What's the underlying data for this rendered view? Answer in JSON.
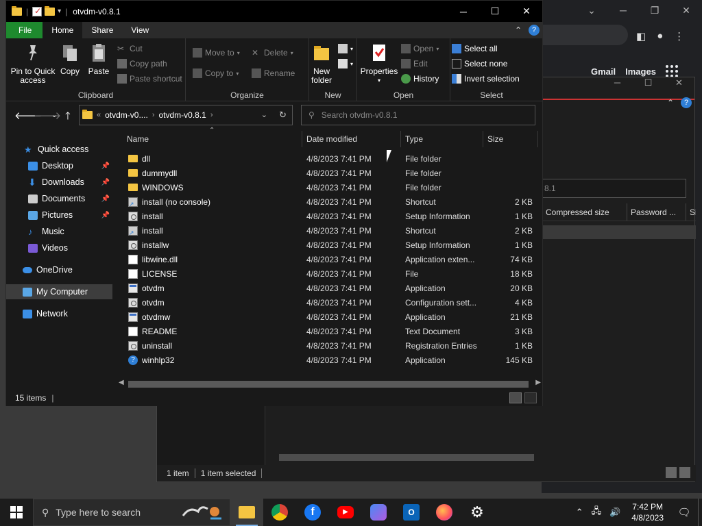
{
  "explorer": {
    "title": "otvdm-v0.8.1",
    "window_buttons": {
      "minimize": "─",
      "maximize": "☐",
      "close": "✕"
    },
    "tabs": [
      {
        "label": "File"
      },
      {
        "label": "Home"
      },
      {
        "label": "Share"
      },
      {
        "label": "View"
      }
    ],
    "ribbon": {
      "clipboard": {
        "label": "Clipboard",
        "pin": "Pin to Quick access",
        "copy": "Copy",
        "paste": "Paste",
        "cut": "Cut",
        "copy_path": "Copy path",
        "paste_shortcut": "Paste shortcut"
      },
      "organize": {
        "label": "Organize",
        "move_to": "Move to",
        "copy_to": "Copy to",
        "delete": "Delete",
        "rename": "Rename"
      },
      "new": {
        "label": "New",
        "new_folder": "New folder"
      },
      "open": {
        "label": "Open",
        "properties": "Properties",
        "open": "Open",
        "edit": "Edit",
        "history": "History"
      },
      "select": {
        "label": "Select",
        "select_all": "Select all",
        "select_none": "Select none",
        "invert_selection": "Invert selection"
      }
    },
    "address": {
      "prefix": "«",
      "crumbs": [
        "otvdm-v0....",
        "otvdm-v0.8.1"
      ],
      "search_placeholder": "Search otvdm-v0.8.1"
    },
    "nav": {
      "quick_access": "Quick access",
      "desktop": "Desktop",
      "downloads": "Downloads",
      "documents": "Documents",
      "pictures": "Pictures",
      "music": "Music",
      "videos": "Videos",
      "onedrive": "OneDrive",
      "my_computer": "My Computer",
      "network": "Network"
    },
    "columns": {
      "name": "Name",
      "date": "Date modified",
      "type": "Type",
      "size": "Size"
    },
    "files": [
      {
        "name": "dll",
        "date": "4/8/2023 7:41 PM",
        "type": "File folder",
        "size": "",
        "icon": "folder"
      },
      {
        "name": "dummydll",
        "date": "4/8/2023 7:41 PM",
        "type": "File folder",
        "size": "",
        "icon": "folder"
      },
      {
        "name": "WINDOWS",
        "date": "4/8/2023 7:41 PM",
        "type": "File folder",
        "size": "",
        "icon": "folder"
      },
      {
        "name": "install (no console)",
        "date": "4/8/2023 7:41 PM",
        "type": "Shortcut",
        "size": "2 KB",
        "icon": "shortcut"
      },
      {
        "name": "install",
        "date": "4/8/2023 7:41 PM",
        "type": "Setup Information",
        "size": "1 KB",
        "icon": "setup"
      },
      {
        "name": "install",
        "date": "4/8/2023 7:41 PM",
        "type": "Shortcut",
        "size": "2 KB",
        "icon": "shortcut"
      },
      {
        "name": "installw",
        "date": "4/8/2023 7:41 PM",
        "type": "Setup Information",
        "size": "1 KB",
        "icon": "setup"
      },
      {
        "name": "libwine.dll",
        "date": "4/8/2023 7:41 PM",
        "type": "Application exten...",
        "size": "74 KB",
        "icon": "doc"
      },
      {
        "name": "LICENSE",
        "date": "4/8/2023 7:41 PM",
        "type": "File",
        "size": "18 KB",
        "icon": "doc"
      },
      {
        "name": "otvdm",
        "date": "4/8/2023 7:41 PM",
        "type": "Application",
        "size": "20 KB",
        "icon": "app"
      },
      {
        "name": "otvdm",
        "date": "4/8/2023 7:41 PM",
        "type": "Configuration sett...",
        "size": "4 KB",
        "icon": "setup"
      },
      {
        "name": "otvdmw",
        "date": "4/8/2023 7:41 PM",
        "type": "Application",
        "size": "21 KB",
        "icon": "app"
      },
      {
        "name": "README",
        "date": "4/8/2023 7:41 PM",
        "type": "Text Document",
        "size": "3 KB",
        "icon": "doc"
      },
      {
        "name": "uninstall",
        "date": "4/8/2023 7:41 PM",
        "type": "Registration Entries",
        "size": "1 KB",
        "icon": "setup"
      },
      {
        "name": "winhlp32",
        "date": "4/8/2023 7:41 PM",
        "type": "Application",
        "size": "145 KB",
        "icon": "help"
      }
    ],
    "status": {
      "items": "15 items"
    }
  },
  "background_zip": {
    "path_fragment": "8.1",
    "columns": [
      "Compressed size",
      "Password ...",
      "Si"
    ],
    "status_items": "1 item",
    "status_selected": "1 item selected"
  },
  "chrome": {
    "gmail": "Gmail",
    "images": "Images"
  },
  "taskbar": {
    "search_placeholder": "Type here to search",
    "time": "7:42 PM",
    "date": "4/8/2023"
  },
  "colors": {
    "file_tab": "#1e8a2e",
    "folder": "#f4c542",
    "accent": "#2f7fd6"
  }
}
